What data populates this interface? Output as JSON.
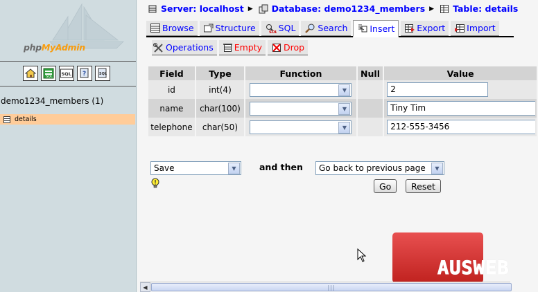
{
  "logo": {
    "php": "php",
    "my": "My",
    "admin": "Admin"
  },
  "sidebar": {
    "quick_icons": [
      "home-icon",
      "query-window-icon",
      "sql-icon",
      "docs-icon",
      "sql-docs-icon"
    ],
    "database": "demo1234_members (1)",
    "tables": [
      "details"
    ]
  },
  "breadcrumb": {
    "server": "Server: localhost",
    "database": "Database: demo1234_members",
    "table": "Table: details"
  },
  "tabs": {
    "row1": [
      {
        "label": "Browse",
        "icon": "browse-icon"
      },
      {
        "label": "Structure",
        "icon": "structure-icon"
      },
      {
        "label": "SQL",
        "icon": "sql-icon"
      },
      {
        "label": "Search",
        "icon": "search-icon"
      },
      {
        "label": "Insert",
        "icon": "insert-icon",
        "active": true
      },
      {
        "label": "Export",
        "icon": "export-icon"
      },
      {
        "label": "Import",
        "icon": "import-icon"
      }
    ],
    "row2": [
      {
        "label": "Operations",
        "icon": "operations-icon"
      },
      {
        "label": "Empty",
        "icon": "empty-icon"
      },
      {
        "label": "Drop",
        "icon": "drop-icon"
      }
    ]
  },
  "insert_table": {
    "headers": [
      "Field",
      "Type",
      "Function",
      "Null",
      "Value"
    ],
    "rows": [
      {
        "field": "id",
        "type": "int(4)",
        "function": "",
        "value": "2"
      },
      {
        "field": "name",
        "type": "char(100)",
        "function": "",
        "value": "Tiny Tim"
      },
      {
        "field": "telephone",
        "type": "char(50)",
        "function": "",
        "value": "212-555-3456"
      }
    ]
  },
  "controls": {
    "action": "Save",
    "and_then": "and then",
    "after": "Go back to previous page",
    "go": "Go",
    "reset": "Reset"
  },
  "watermark": {
    "text": "AUSWEB"
  },
  "colors": {
    "link": "#0000ff",
    "danger": "#ff0000",
    "sidebar_bg": "#d0dce0",
    "selected_table": "#ffcc99"
  }
}
